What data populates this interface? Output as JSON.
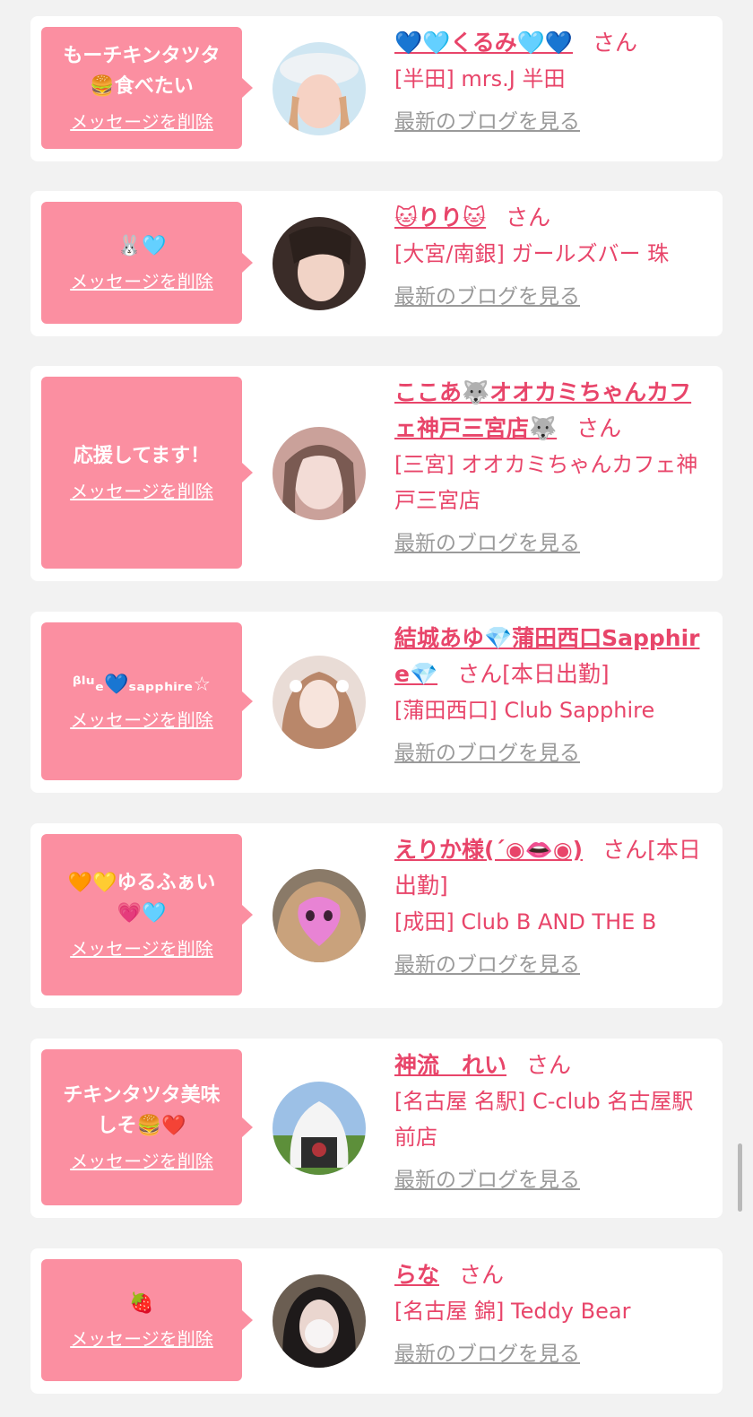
{
  "colors": {
    "background": "#f2f2f2",
    "card": "#ffffff",
    "bubble": "#fb8fa1",
    "accent_text": "#e8456a",
    "link_gray": "#9a9a9a"
  },
  "entries": [
    {
      "message": "もーチキンタツタ\n🍔食べたい",
      "delete_label": "メッセージを削除",
      "name": "💙🩵くるみ🩵💙",
      "honorific": "さん",
      "status": "",
      "shop": "[半田] mrs.J 半田",
      "blog_link": "最新のブログを見る",
      "avatar_icon": "profile-photo-icon"
    },
    {
      "message": "🐰🩵",
      "delete_label": "メッセージを削除",
      "name": "🐱りり🐱",
      "honorific": "さん",
      "status": "",
      "shop": "[大宮/南銀] ガールズバー 珠",
      "blog_link": "最新のブログを見る",
      "avatar_icon": "profile-photo-icon"
    },
    {
      "message": "応援してます！",
      "delete_label": "メッセージを削除",
      "name": "ここあ🐺オオカミちゃんカフェ神戸三宮店🐺",
      "honorific": "さん",
      "status": "",
      "shop": "[三宮] オオカミちゃんカフェ神戸三宮店",
      "blog_link": "最新のブログを見る",
      "avatar_icon": "profile-photo-icon"
    },
    {
      "message": "ᵝˡᵘₑ💙ₛₐₚₚₕᵢᵣₑ☆",
      "delete_label": "メッセージを削除",
      "name": "結城あゆ💎蒲田西口Sapphire💎",
      "honorific": "さん",
      "status": "[本日出勤]",
      "shop": "[蒲田西口] Club Sapphire",
      "blog_link": "最新のブログを見る",
      "avatar_icon": "profile-photo-icon"
    },
    {
      "message": "🧡💛ゆるふぁい\n💗🩵",
      "delete_label": "メッセージを削除",
      "name": "えりか様(´◉👄◉)",
      "honorific": "さん",
      "status": "[本日出勤]",
      "shop": "[成田] Club B AND THE B",
      "blog_link": "最新のブログを見る",
      "avatar_icon": "profile-photo-icon"
    },
    {
      "message": "チキンタツタ美味\nしそ🍔❤️",
      "delete_label": "メッセージを削除",
      "name": "神流　れい",
      "honorific": "さん",
      "status": "",
      "shop": "[名古屋 名駅] C-club 名古屋駅前店",
      "blog_link": "最新のブログを見る",
      "avatar_icon": "profile-photo-icon"
    },
    {
      "message": "🍓",
      "delete_label": "メッセージを削除",
      "name": "らな",
      "honorific": "さん",
      "status": "",
      "shop": "[名古屋 錦] Teddy Bear",
      "blog_link": "最新のブログを見る",
      "avatar_icon": "profile-photo-icon"
    }
  ]
}
